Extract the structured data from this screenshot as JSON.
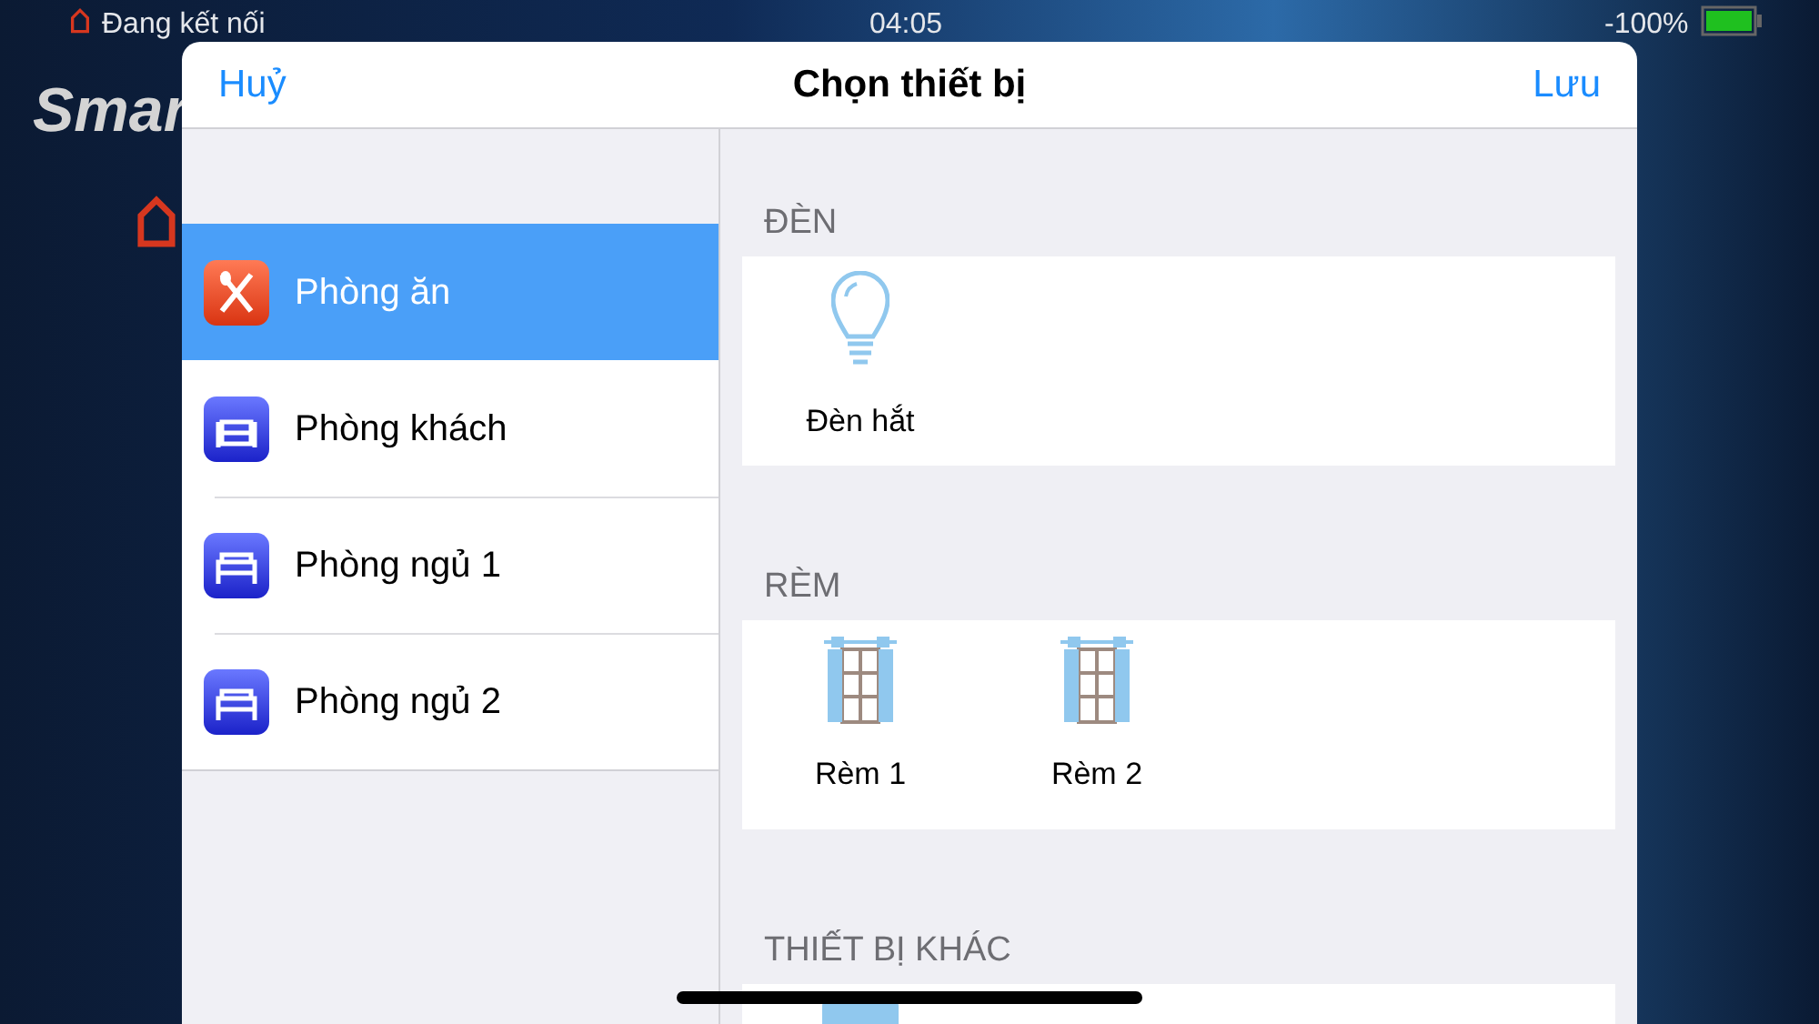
{
  "status_bar": {
    "connection": "Đang kết nối",
    "time": "04:05",
    "battery": "-100%"
  },
  "background": {
    "app_title": "Smar"
  },
  "dialog": {
    "cancel": "Huỷ",
    "title": "Chọn thiết bị",
    "save": "Lưu"
  },
  "rooms": [
    {
      "name": "Phòng ăn",
      "kind": "dining",
      "selected": true
    },
    {
      "name": "Phòng khách",
      "kind": "living",
      "selected": false
    },
    {
      "name": "Phòng ngủ 1",
      "kind": "bed",
      "selected": false
    },
    {
      "name": "Phòng ngủ 2",
      "kind": "bed",
      "selected": false
    }
  ],
  "sections": [
    {
      "title": "ĐÈN",
      "devices": [
        {
          "name": "Đèn hắt",
          "kind": "bulb"
        }
      ]
    },
    {
      "title": "RÈM",
      "devices": [
        {
          "name": "Rèm 1",
          "kind": "curtain"
        },
        {
          "name": "Rèm 2",
          "kind": "curtain"
        }
      ]
    },
    {
      "title": "THIẾT BỊ KHÁC",
      "devices": [
        {
          "kind": "device"
        }
      ]
    }
  ]
}
